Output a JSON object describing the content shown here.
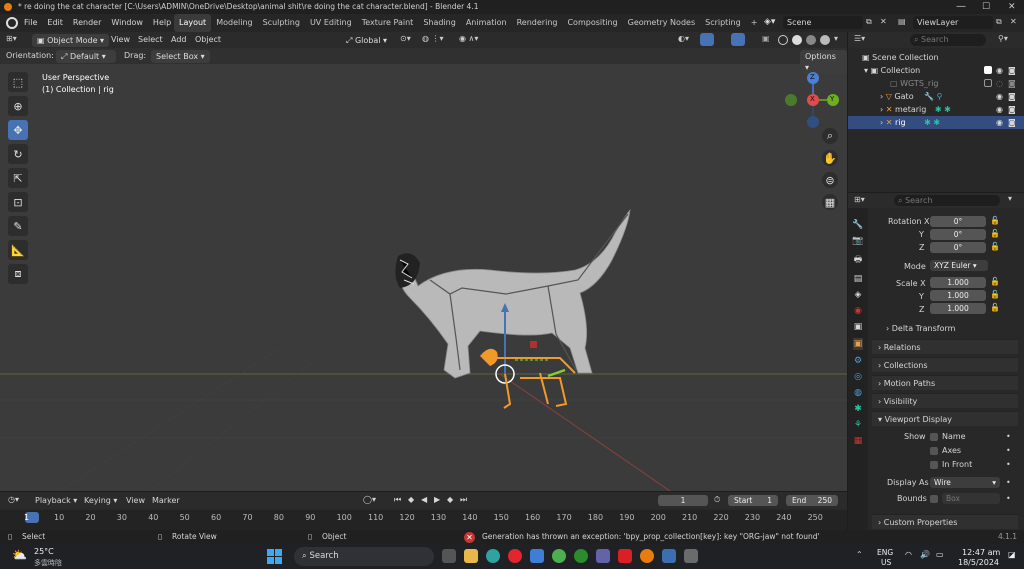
{
  "window": {
    "title": "* re doing the cat character [C:\\Users\\ADMIN\\OneDrive\\Desktop\\animal shit\\re doing the cat character.blend] - Blender 4.1"
  },
  "menu": [
    "File",
    "Edit",
    "Render",
    "Window",
    "Help"
  ],
  "workspaces": [
    "Layout",
    "Modeling",
    "Sculpting",
    "UV Editing",
    "Texture Paint",
    "Shading",
    "Animation",
    "Rendering",
    "Compositing",
    "Geometry Nodes",
    "Scripting"
  ],
  "scene": {
    "name": "Scene",
    "view_layer": "ViewLayer"
  },
  "viewport_header": {
    "mode": "Object Mode",
    "view": "View",
    "select": "Select",
    "add": "Add",
    "object": "Object",
    "transform": "Global"
  },
  "tool_settings": {
    "orientation_label": "Orientation:",
    "orientation": "Default",
    "drag_label": "Drag:",
    "drag": "Select Box",
    "options": "Options"
  },
  "viewport": {
    "perspective": "User Perspective",
    "collection": "(1) Collection | rig"
  },
  "gizmo": {
    "z": "Z",
    "x": "X",
    "y": "Y"
  },
  "outliner": {
    "search_placeholder": "Search",
    "items": [
      "Scene Collection",
      "Collection",
      "WGTS_rig",
      "Gato",
      "metarig",
      "rig"
    ]
  },
  "properties": {
    "search_placeholder": "Search",
    "rotation_label": "Rotation X",
    "y_label": "Y",
    "z_label": "Z",
    "rotation": [
      "0°",
      "0°",
      "0°"
    ],
    "mode_label": "Mode",
    "mode": "XYZ Euler",
    "scale_label": "Scale X",
    "scale": [
      "1.000",
      "1.000",
      "1.000"
    ],
    "delta": "Delta Transform",
    "sections": [
      "Relations",
      "Collections",
      "Motion Paths",
      "Visibility",
      "Viewport Display"
    ],
    "show_label": "Show",
    "name": "Name",
    "axes": "Axes",
    "in_front": "In Front",
    "display_as_label": "Display As",
    "display_as": "Wire",
    "bounds_label": "Bounds",
    "bounds": "Box",
    "custom": "Custom Properties"
  },
  "timeline": {
    "playback": "Playback",
    "keying": "Keying",
    "view": "View",
    "marker": "Marker",
    "frame": "1",
    "start_label": "Start",
    "start": "1",
    "end_label": "End",
    "end": "250",
    "ticks": [
      "1",
      "10",
      "20",
      "30",
      "40",
      "50",
      "60",
      "70",
      "80",
      "90",
      "100",
      "110",
      "120",
      "130",
      "140",
      "150",
      "160",
      "170",
      "180",
      "190",
      "200",
      "210",
      "220",
      "230",
      "240",
      "250"
    ]
  },
  "statusbar": {
    "select": "Select",
    "rotate": "Rotate View",
    "object": "Object",
    "error": "Generation has thrown an exception: 'bpy_prop_collection[key]: key \"ORG-jaw\" not found'",
    "version": "4.1.1"
  },
  "taskbar": {
    "temp": "25°C",
    "weather": "多雲時陰",
    "search": "Search",
    "lang1": "ENG",
    "lang2": "US",
    "time": "12:47 am",
    "date": "18/5/2024"
  }
}
